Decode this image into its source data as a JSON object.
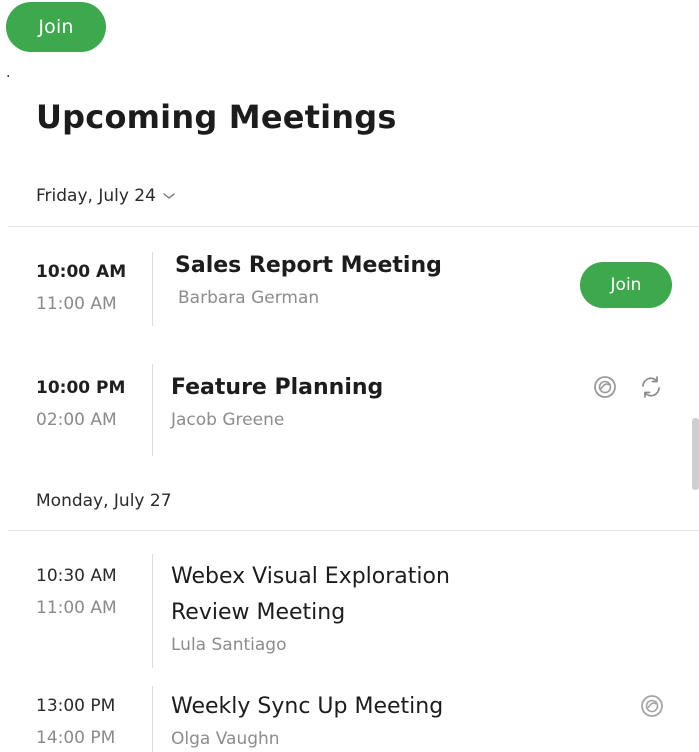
{
  "top_join_label": "Join",
  "stray_text": ".",
  "title": "Upcoming Meetings",
  "days": [
    {
      "label": "Friday, July 24",
      "meetings": [
        {
          "start": "10:00 AM",
          "end": "11:00 AM",
          "title": "Sales Report Meeting",
          "host": "Barbara German",
          "join_label": "Join"
        },
        {
          "start": "10:00 PM",
          "end": "02:00 AM",
          "title": "Feature Planning",
          "host": "Jacob Greene",
          "icons": [
            "webex-icon",
            "recurring-icon"
          ]
        }
      ]
    },
    {
      "label": "Monday, July 27",
      "meetings": [
        {
          "start": "10:30 AM",
          "end": "11:00 AM",
          "title_line1": "Webex Visual Exploration",
          "title_line2": "Review Meeting",
          "host": "Lula Santiago"
        },
        {
          "start": "13:00 PM",
          "end": "14:00 PM",
          "title": "Weekly Sync Up Meeting",
          "host": "Olga Vaughn",
          "icons": [
            "webex-icon"
          ]
        }
      ]
    }
  ],
  "colors": {
    "join_green": "#3ea84c",
    "muted_text": "#8c8c8c",
    "divider": "#e6e6e6"
  }
}
